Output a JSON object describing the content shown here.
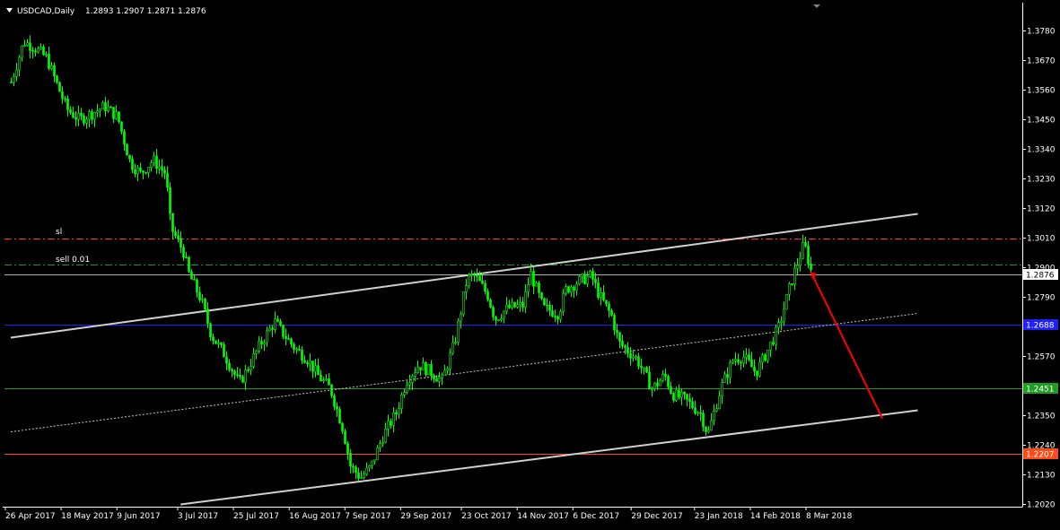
{
  "header": {
    "symbol_label": "USDCAD,Daily",
    "ohlc_label": "1.2893 1.2907 1.2871 1.2876",
    "menu_icon": "triangle-down-icon",
    "scroll_marker_icon": "triangle-down-icon"
  },
  "colors": {
    "background": "#000000",
    "candle": "#00ff00",
    "axis": "#ffffff",
    "channel": "#d0d0d0",
    "midline": "#c8c8c8",
    "sl_line": "#ff3030",
    "sell_line": "#1e9e1e",
    "price_line": "#b0b0b0",
    "blue_level": "#2020ff",
    "green_level": "#1e9e1e",
    "orange_level": "#ff4a1a",
    "arrow": "#ff0000"
  },
  "chart_data": {
    "type": "candlestick",
    "symbol": "USDCAD",
    "timeframe": "Daily",
    "ylim": [
      1.202,
      1.383
    ],
    "y_ticks": [
      "1.3780",
      "1.3670",
      "1.3560",
      "1.3450",
      "1.3340",
      "1.3230",
      "1.3120",
      "1.3010",
      "1.2900",
      "1.2790",
      "1.2680",
      "1.2570",
      "1.2460",
      "1.2350",
      "1.2240",
      "1.2130",
      "1.2020"
    ],
    "x_ticks": [
      {
        "date": "2017-04-26",
        "label": "26 Apr 2017"
      },
      {
        "date": "2017-05-18",
        "label": "18 May 2017"
      },
      {
        "date": "2017-06-09",
        "label": "9 Jun 2017"
      },
      {
        "date": "2017-07-03",
        "label": "3 Jul 2017"
      },
      {
        "date": "2017-07-25",
        "label": "25 Jul 2017"
      },
      {
        "date": "2017-08-16",
        "label": "16 Aug 2017"
      },
      {
        "date": "2017-09-07",
        "label": "7 Sep 2017"
      },
      {
        "date": "2017-09-29",
        "label": "29 Sep 2017"
      },
      {
        "date": "2017-10-23",
        "label": "23 Oct 2017"
      },
      {
        "date": "2017-11-14",
        "label": "14 Nov 2017"
      },
      {
        "date": "2017-12-06",
        "label": "6 Dec 2017"
      },
      {
        "date": "2017-12-29",
        "label": "29 Dec 2017"
      },
      {
        "date": "2018-01-23",
        "label": "23 Jan 2018"
      },
      {
        "date": "2018-02-14",
        "label": "14 Feb 2018"
      },
      {
        "date": "2018-03-08",
        "label": "8 Mar 2018"
      }
    ],
    "close_path": [
      {
        "date": "2017-04-26",
        "close": 1.359
      },
      {
        "date": "2017-05-01",
        "close": 1.374
      },
      {
        "date": "2017-05-05",
        "close": 1.372
      },
      {
        "date": "2017-05-10",
        "close": 1.368
      },
      {
        "date": "2017-05-15",
        "close": 1.356
      },
      {
        "date": "2017-05-18",
        "close": 1.349
      },
      {
        "date": "2017-05-23",
        "close": 1.345
      },
      {
        "date": "2017-05-29",
        "close": 1.348
      },
      {
        "date": "2017-06-02",
        "close": 1.35
      },
      {
        "date": "2017-06-07",
        "close": 1.346
      },
      {
        "date": "2017-06-12",
        "close": 1.329
      },
      {
        "date": "2017-06-16",
        "close": 1.325
      },
      {
        "date": "2017-06-21",
        "close": 1.33
      },
      {
        "date": "2017-06-26",
        "close": 1.325
      },
      {
        "date": "2017-06-28",
        "close": 1.305
      },
      {
        "date": "2017-07-03",
        "close": 1.296
      },
      {
        "date": "2017-07-05",
        "close": 1.288
      },
      {
        "date": "2017-07-10",
        "close": 1.278
      },
      {
        "date": "2017-07-14",
        "close": 1.265
      },
      {
        "date": "2017-07-19",
        "close": 1.258
      },
      {
        "date": "2017-07-25",
        "close": 1.247
      },
      {
        "date": "2017-07-28",
        "close": 1.252
      },
      {
        "date": "2017-08-02",
        "close": 1.261
      },
      {
        "date": "2017-08-08",
        "close": 1.27
      },
      {
        "date": "2017-08-11",
        "close": 1.266
      },
      {
        "date": "2017-08-16",
        "close": 1.26
      },
      {
        "date": "2017-08-21",
        "close": 1.256
      },
      {
        "date": "2017-08-25",
        "close": 1.25
      },
      {
        "date": "2017-08-30",
        "close": 1.245
      },
      {
        "date": "2017-09-04",
        "close": 1.23
      },
      {
        "date": "2017-09-07",
        "close": 1.216
      },
      {
        "date": "2017-09-11",
        "close": 1.212
      },
      {
        "date": "2017-09-15",
        "close": 1.216
      },
      {
        "date": "2017-09-20",
        "close": 1.228
      },
      {
        "date": "2017-09-25",
        "close": 1.236
      },
      {
        "date": "2017-09-29",
        "close": 1.248
      },
      {
        "date": "2017-10-04",
        "close": 1.254
      },
      {
        "date": "2017-10-09",
        "close": 1.251
      },
      {
        "date": "2017-10-13",
        "close": 1.248
      },
      {
        "date": "2017-10-18",
        "close": 1.262
      },
      {
        "date": "2017-10-23",
        "close": 1.286
      },
      {
        "date": "2017-10-26",
        "close": 1.287
      },
      {
        "date": "2017-10-31",
        "close": 1.28
      },
      {
        "date": "2017-11-03",
        "close": 1.271
      },
      {
        "date": "2017-11-08",
        "close": 1.275
      },
      {
        "date": "2017-11-14",
        "close": 1.276
      },
      {
        "date": "2017-11-17",
        "close": 1.288
      },
      {
        "date": "2017-11-22",
        "close": 1.275
      },
      {
        "date": "2017-11-28",
        "close": 1.273
      },
      {
        "date": "2017-12-01",
        "close": 1.282
      },
      {
        "date": "2017-12-06",
        "close": 1.285
      },
      {
        "date": "2017-12-11",
        "close": 1.287
      },
      {
        "date": "2017-12-14",
        "close": 1.28
      },
      {
        "date": "2017-12-19",
        "close": 1.272
      },
      {
        "date": "2017-12-22",
        "close": 1.262
      },
      {
        "date": "2017-12-29",
        "close": 1.256
      },
      {
        "date": "2018-01-04",
        "close": 1.245
      },
      {
        "date": "2018-01-09",
        "close": 1.25
      },
      {
        "date": "2018-01-12",
        "close": 1.243
      },
      {
        "date": "2018-01-17",
        "close": 1.241
      },
      {
        "date": "2018-01-23",
        "close": 1.236
      },
      {
        "date": "2018-01-26",
        "close": 1.228
      },
      {
        "date": "2018-01-31",
        "close": 1.245
      },
      {
        "date": "2018-02-05",
        "close": 1.256
      },
      {
        "date": "2018-02-09",
        "close": 1.257
      },
      {
        "date": "2018-02-14",
        "close": 1.251
      },
      {
        "date": "2018-02-19",
        "close": 1.26
      },
      {
        "date": "2018-02-23",
        "close": 1.268
      },
      {
        "date": "2018-02-28",
        "close": 1.285
      },
      {
        "date": "2018-03-05",
        "close": 1.299
      },
      {
        "date": "2018-03-08",
        "close": 1.2876
      }
    ],
    "levels": [
      {
        "name": "sl",
        "label": "sl",
        "price": 1.301,
        "style": "dash-dot",
        "color": "#ff3030"
      },
      {
        "name": "sell",
        "label": "sell 0.01",
        "price": 1.2912,
        "style": "dash-dot",
        "color": "#1e9e1e"
      },
      {
        "name": "current",
        "label": "1.2876",
        "price": 1.2876,
        "style": "solid",
        "color": "#b0b0b0"
      },
      {
        "name": "blue",
        "label": "1.2688",
        "price": 1.2688,
        "style": "solid",
        "color": "#2020ff"
      },
      {
        "name": "green",
        "label": "1.2451",
        "price": 1.2451,
        "style": "solid",
        "color": "#1e9e1e"
      },
      {
        "name": "orange",
        "label": "1.2207",
        "price": 1.2207,
        "style": "solid",
        "color": "#ff4a1a"
      }
    ],
    "trendlines": [
      {
        "name": "channel-upper",
        "from": {
          "date": "2017-04-26",
          "price": 1.264
        },
        "to": {
          "date": "2018-04-19",
          "price": 1.31
        },
        "style": "solid"
      },
      {
        "name": "channel-middle",
        "from": {
          "date": "2017-04-26",
          "price": 1.229
        },
        "to": {
          "date": "2018-04-19",
          "price": 1.273
        },
        "style": "dotted"
      },
      {
        "name": "channel-lower",
        "from": {
          "date": "2017-07-02",
          "price": 1.202
        },
        "to": {
          "date": "2018-04-19",
          "price": 1.237
        },
        "style": "solid"
      }
    ],
    "arrow": {
      "from": {
        "date": "2018-03-08",
        "price": 1.288
      },
      "to": {
        "date": "2018-04-05",
        "price": 1.234
      }
    },
    "grid": false
  }
}
